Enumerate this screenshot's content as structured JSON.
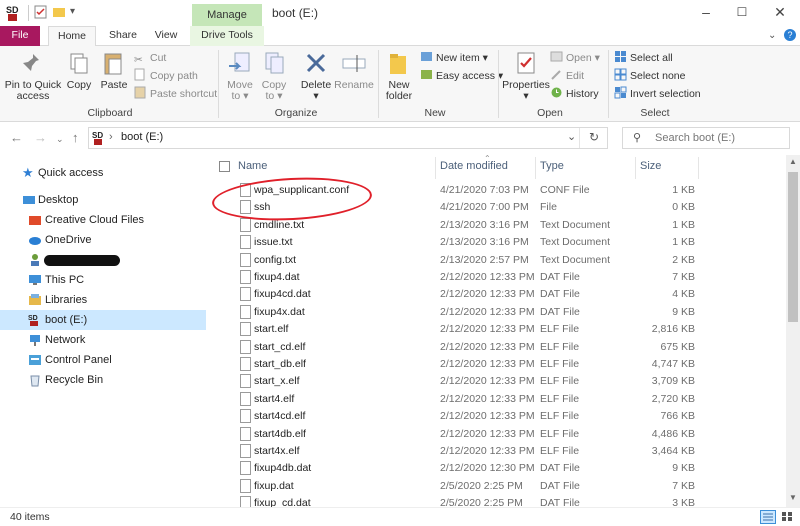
{
  "window": {
    "title": "boot (E:)",
    "context_tab": "Manage",
    "controls": [
      "–",
      "☐",
      "✕"
    ]
  },
  "tabs": {
    "file": "File",
    "home": "Home",
    "share": "Share",
    "view": "View",
    "drive_tools": "Drive Tools"
  },
  "ribbon": {
    "clipboard": {
      "pin": [
        "Pin to Quick",
        "access"
      ],
      "copy": "Copy",
      "paste": "Paste",
      "cut": "Cut",
      "copy_path": "Copy path",
      "paste_shortcut": "Paste shortcut",
      "label": "Clipboard"
    },
    "organize": {
      "move_to": [
        "Move",
        "to ▾"
      ],
      "copy_to": [
        "Copy",
        "to ▾"
      ],
      "delete": [
        "Delete",
        "▾"
      ],
      "rename": "Rename",
      "label": "Organize"
    },
    "new": {
      "new_folder": [
        "New",
        "folder"
      ],
      "new_item": "New item ▾",
      "easy_access": "Easy access ▾",
      "label": "New"
    },
    "open": {
      "properties": [
        "Properties",
        "▾"
      ],
      "open": "Open ▾",
      "edit": "Edit",
      "history": "History",
      "label": "Open"
    },
    "select": {
      "select_all": "Select all",
      "select_none": "Select none",
      "invert": "Invert selection",
      "label": "Select"
    }
  },
  "address": {
    "path": "boot (E:)",
    "separator": "›",
    "search_placeholder": "Search boot (E:)"
  },
  "nav": {
    "items": [
      {
        "label": "Quick access",
        "icon": "star-icon"
      },
      {
        "label": "Desktop",
        "icon": "desktop-icon"
      },
      {
        "label": "Creative Cloud Files",
        "icon": "cloud-folder-icon"
      },
      {
        "label": "OneDrive",
        "icon": "onedrive-icon"
      },
      {
        "label": "",
        "icon": "user-icon"
      },
      {
        "label": "This PC",
        "icon": "pc-icon"
      },
      {
        "label": "Libraries",
        "icon": "libraries-icon"
      },
      {
        "label": "boot (E:)",
        "icon": "sd-card-icon"
      },
      {
        "label": "Network",
        "icon": "network-icon"
      },
      {
        "label": "Control Panel",
        "icon": "control-panel-icon"
      },
      {
        "label": "Recycle Bin",
        "icon": "recycle-bin-icon"
      }
    ]
  },
  "columns": {
    "name": "Name",
    "date": "Date modified",
    "type": "Type",
    "size": "Size"
  },
  "files": [
    {
      "name": "wpa_supplicant.conf",
      "date": "4/21/2020 7:03 PM",
      "type": "CONF File",
      "size": "1 KB"
    },
    {
      "name": "ssh",
      "date": "4/21/2020 7:00 PM",
      "type": "File",
      "size": "0 KB"
    },
    {
      "name": "cmdline.txt",
      "date": "2/13/2020 3:16 PM",
      "type": "Text Document",
      "size": "1 KB"
    },
    {
      "name": "issue.txt",
      "date": "2/13/2020 3:16 PM",
      "type": "Text Document",
      "size": "1 KB"
    },
    {
      "name": "config.txt",
      "date": "2/13/2020 2:57 PM",
      "type": "Text Document",
      "size": "2 KB"
    },
    {
      "name": "fixup4.dat",
      "date": "2/12/2020 12:33 PM",
      "type": "DAT File",
      "size": "7 KB"
    },
    {
      "name": "fixup4cd.dat",
      "date": "2/12/2020 12:33 PM",
      "type": "DAT File",
      "size": "4 KB"
    },
    {
      "name": "fixup4x.dat",
      "date": "2/12/2020 12:33 PM",
      "type": "DAT File",
      "size": "9 KB"
    },
    {
      "name": "start.elf",
      "date": "2/12/2020 12:33 PM",
      "type": "ELF File",
      "size": "2,816 KB"
    },
    {
      "name": "start_cd.elf",
      "date": "2/12/2020 12:33 PM",
      "type": "ELF File",
      "size": "675 KB"
    },
    {
      "name": "start_db.elf",
      "date": "2/12/2020 12:33 PM",
      "type": "ELF File",
      "size": "4,747 KB"
    },
    {
      "name": "start_x.elf",
      "date": "2/12/2020 12:33 PM",
      "type": "ELF File",
      "size": "3,709 KB"
    },
    {
      "name": "start4.elf",
      "date": "2/12/2020 12:33 PM",
      "type": "ELF File",
      "size": "2,720 KB"
    },
    {
      "name": "start4cd.elf",
      "date": "2/12/2020 12:33 PM",
      "type": "ELF File",
      "size": "766 KB"
    },
    {
      "name": "start4db.elf",
      "date": "2/12/2020 12:33 PM",
      "type": "ELF File",
      "size": "4,486 KB"
    },
    {
      "name": "start4x.elf",
      "date": "2/12/2020 12:33 PM",
      "type": "ELF File",
      "size": "3,464 KB"
    },
    {
      "name": "fixup4db.dat",
      "date": "2/12/2020 12:30 PM",
      "type": "DAT File",
      "size": "9 KB"
    },
    {
      "name": "fixup.dat",
      "date": "2/5/2020 2:25 PM",
      "type": "DAT File",
      "size": "7 KB"
    },
    {
      "name": "fixup_cd.dat",
      "date": "2/5/2020 2:25 PM",
      "type": "DAT File",
      "size": "3 KB"
    }
  ],
  "status": {
    "count": "40 items"
  },
  "colors": {
    "file_tab": "#a8185f",
    "manage_tab": "#c5e6b8",
    "selected_nav": "#cce8ff",
    "annotation_ring": "#e0202a"
  }
}
